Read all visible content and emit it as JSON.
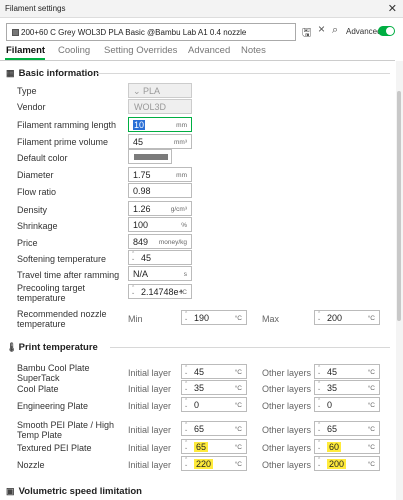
{
  "window": {
    "title": "Filament settings",
    "close": "✕"
  },
  "toolbar": {
    "preset_name": "200+60 C Grey WOL3D PLA Basic @Bambu Lab A1 0.4 nozzle",
    "advanced_label": "Advanced",
    "advanced_on": true,
    "accent_color": "#00ae42"
  },
  "tabs": [
    "Filament",
    "Cooling",
    "Setting Overrides",
    "Advanced",
    "Notes"
  ],
  "sections": {
    "basic": "Basic information",
    "print_temp": "Print temperature",
    "volumetric": "Volumetric speed limitation"
  },
  "basic": {
    "type": {
      "label": "Type",
      "value": "PLA"
    },
    "vendor": {
      "label": "Vendor",
      "value": "WOL3D"
    },
    "ramming": {
      "label": "Filament ramming length",
      "value": "10",
      "unit": "mm"
    },
    "prime": {
      "label": "Filament prime volume",
      "value": "45",
      "unit": "mm³"
    },
    "color": {
      "label": "Default color",
      "value": "#7b7b7b"
    },
    "diameter": {
      "label": "Diameter",
      "value": "1.75",
      "unit": "mm"
    },
    "flow": {
      "label": "Flow ratio",
      "value": "0.98"
    },
    "density": {
      "label": "Density",
      "value": "1.26",
      "unit": "g/cm³"
    },
    "shrinkage": {
      "label": "Shrinkage",
      "value": "100",
      "unit": "%"
    },
    "price": {
      "label": "Price",
      "value": "849",
      "unit": "money/kg"
    },
    "softening": {
      "label": "Softening temperature",
      "value": "45"
    },
    "travel": {
      "label": "Travel time after ramming",
      "value": "N/A",
      "unit": "s"
    },
    "precool": {
      "label1": "Precooling target",
      "label2": "temperature",
      "value": "2.14748e+",
      "unit": "°C"
    },
    "recommended": {
      "label1": "Recommended nozzle",
      "label2": "temperature",
      "min_label": "Min",
      "min_value": "190",
      "max_label": "Max",
      "max_value": "200",
      "unit": "°C"
    }
  },
  "temp_headers": {
    "initial": "Initial layer",
    "other": "Other layers",
    "unit": "°C"
  },
  "plates": [
    {
      "l1": "Bambu Cool Plate",
      "l2": "SuperTack",
      "initial": "45",
      "other": "45",
      "highlight": false
    },
    {
      "l1": "Cool Plate",
      "l2": "",
      "initial": "35",
      "other": "35",
      "highlight": false
    },
    {
      "l1": "Engineering Plate",
      "l2": "",
      "initial": "0",
      "other": "0",
      "highlight": false
    },
    {
      "l1": "Smooth PEI Plate / High",
      "l2": "Temp Plate",
      "initial": "65",
      "other": "65",
      "highlight": false
    },
    {
      "l1": "Textured PEI Plate",
      "l2": "",
      "initial": "65",
      "other": "60",
      "highlight": true
    },
    {
      "l1": "Nozzle",
      "l2": "",
      "initial": "220",
      "other": "200",
      "highlight": true
    }
  ],
  "highlight_color": "#ffeb3b"
}
